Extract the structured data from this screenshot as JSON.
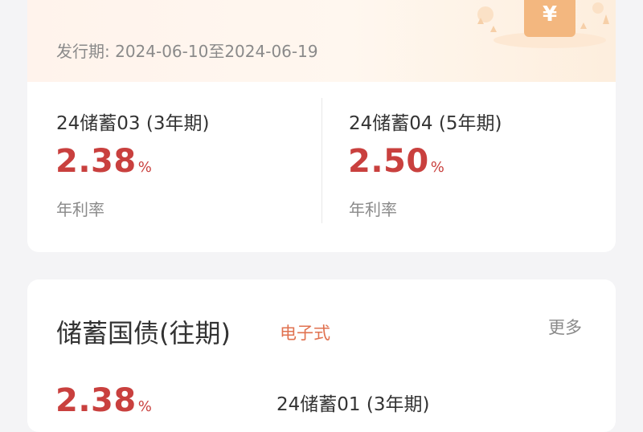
{
  "current": {
    "issue_period": "发行期: 2024-06-10至2024-06-19",
    "bonds": [
      {
        "name": "24储蓄03 (3年期)",
        "rate": "2.38",
        "unit": "%",
        "rate_label": "年利率"
      },
      {
        "name": "24储蓄04 (5年期)",
        "rate": "2.50",
        "unit": "%",
        "rate_label": "年利率"
      }
    ]
  },
  "past": {
    "title": "储蓄国债(往期)",
    "tag": "电子式",
    "more_label": "更多",
    "bonds": [
      {
        "name": "24储蓄01 (3年期)",
        "rate": "2.38",
        "unit": "%"
      }
    ]
  },
  "colors": {
    "rate_red": "#c9403e",
    "tag_orange": "#e0714f",
    "banner_gold": "#f3b77f"
  },
  "icons": {
    "banner_decoration": "yuan-envelope-icon"
  }
}
